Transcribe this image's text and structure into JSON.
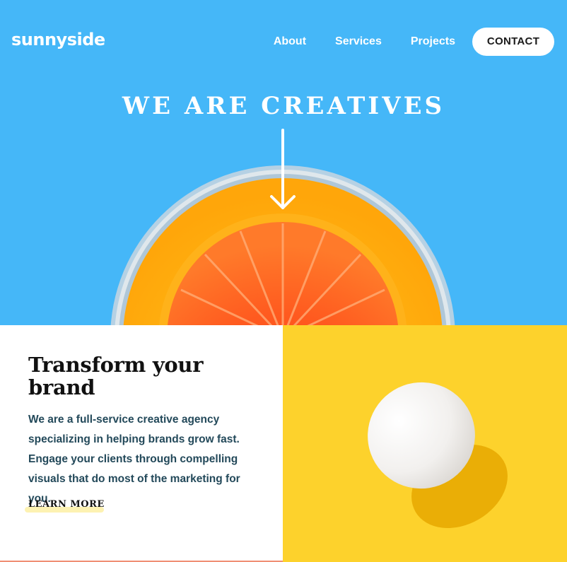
{
  "header": {
    "logo": "sunnyside",
    "nav": [
      {
        "label": "About"
      },
      {
        "label": "Services"
      },
      {
        "label": "Projects"
      }
    ],
    "contact_label": "CONTACT"
  },
  "hero": {
    "title": "WE ARE CREATIVES",
    "background_color": "#45b7f8"
  },
  "feature": {
    "heading": "Transform your brand",
    "body": "We are a full-service creative agency specializing in helping brands grow fast. Engage your clients through compelling visuals that do most of the marketing for you.",
    "link_label": "LEARN MORE",
    "image_background": "#fdd22c"
  },
  "icons": {
    "hero_arrow": "arrow-down-icon"
  }
}
